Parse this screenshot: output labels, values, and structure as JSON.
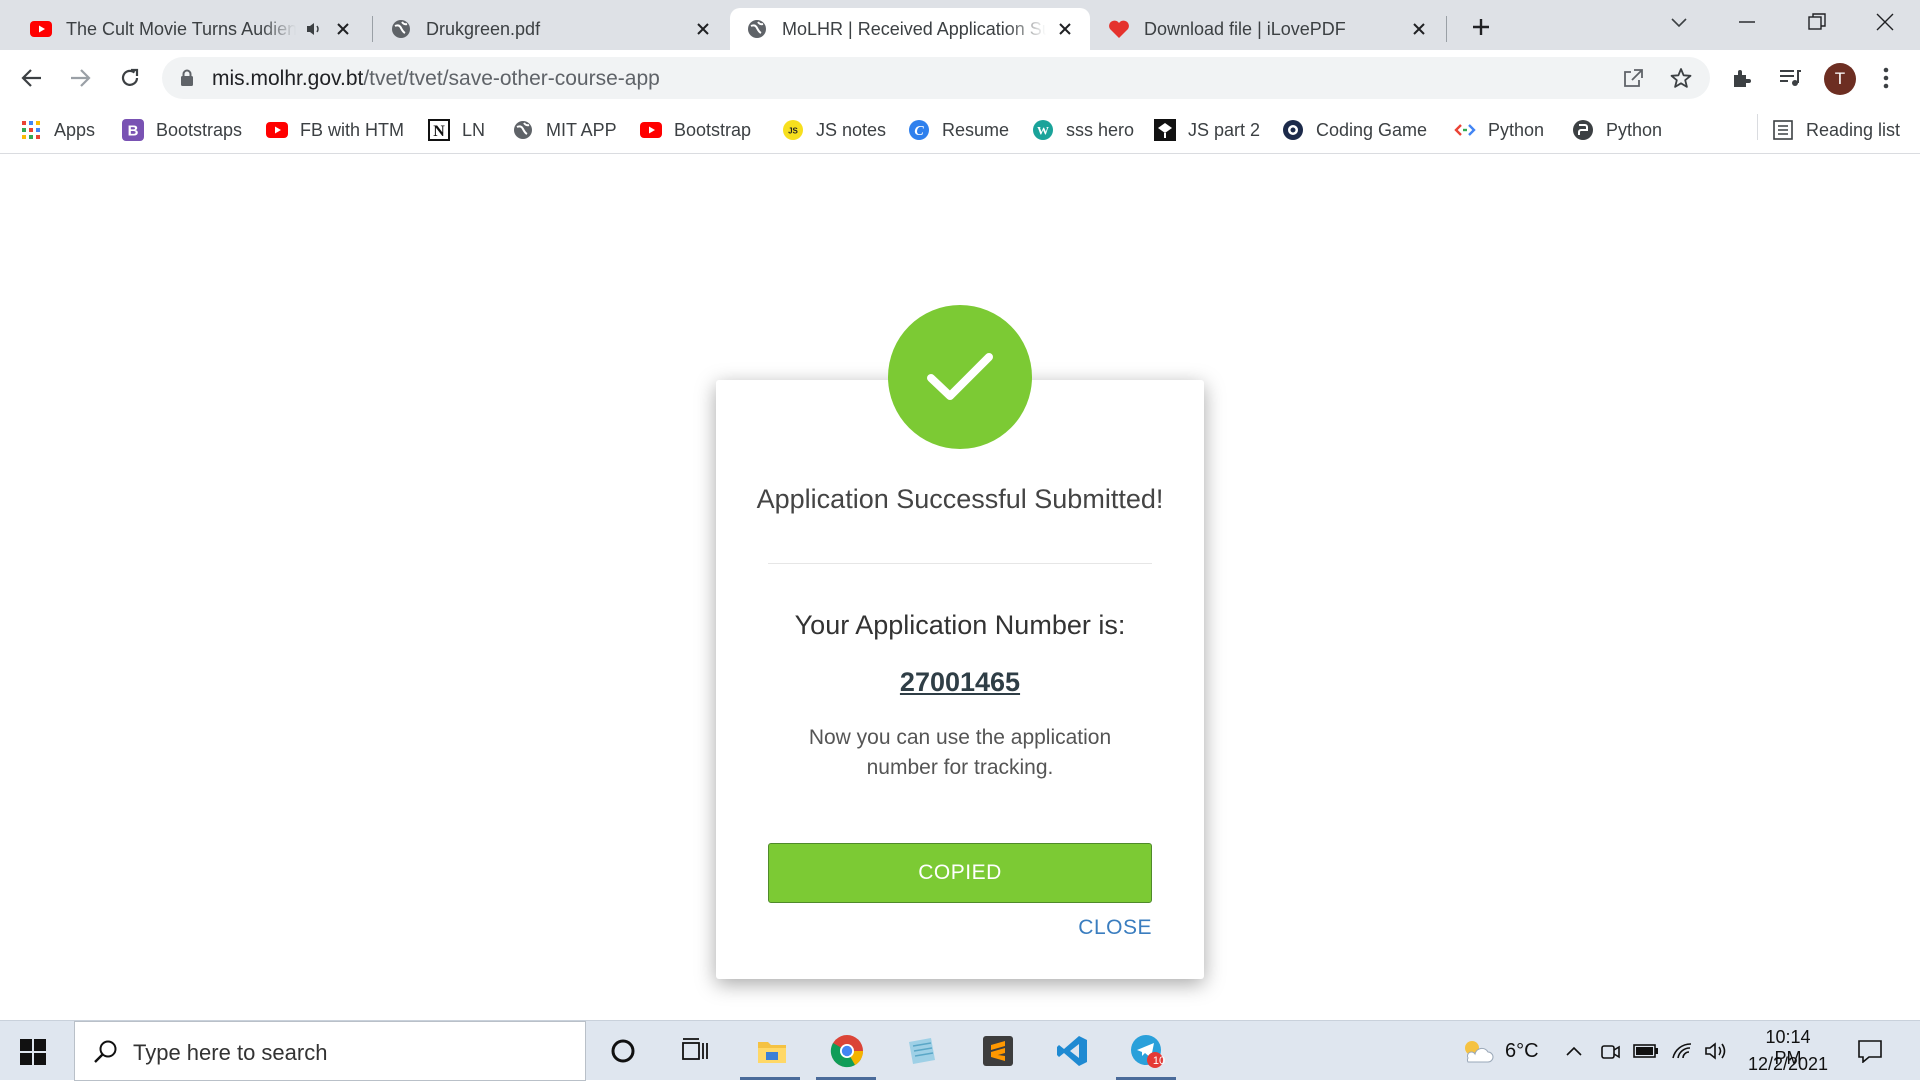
{
  "tabs": [
    {
      "title": "The Cult Movie Turns Audien",
      "favicon": "youtube-icon",
      "muted_icon": "speaker-icon"
    },
    {
      "title": "Drukgreen.pdf",
      "favicon": "globe-icon"
    },
    {
      "title": "MoLHR | Received Application Su",
      "favicon": "globe-icon",
      "active": true
    },
    {
      "title": "Download file | iLovePDF",
      "favicon": "heart-icon"
    }
  ],
  "address_bar": {
    "domain": "mis.molhr.gov.bt",
    "path": "/tvet/tvet/save-other-course-app"
  },
  "profile": {
    "initial": "T"
  },
  "bookmarks": [
    {
      "label": "Apps",
      "icon": "apps-grid-icon"
    },
    {
      "label": "Bootstraps",
      "icon": "bootstrap-icon"
    },
    {
      "label": "FB with HTM",
      "icon": "youtube-icon"
    },
    {
      "label": "LN",
      "icon": "notion-icon"
    },
    {
      "label": "MIT APP",
      "icon": "globe-icon"
    },
    {
      "label": "Bootstrap",
      "icon": "youtube-icon"
    },
    {
      "label": "JS notes",
      "icon": "js-icon"
    },
    {
      "label": "Resume",
      "icon": "canva-icon"
    },
    {
      "label": "sss hero",
      "icon": "wordpress-icon"
    },
    {
      "label": "JS part 2",
      "icon": "codepen-icon"
    },
    {
      "label": "Coding Game",
      "icon": "codingame-icon"
    },
    {
      "label": "Python",
      "icon": "code-brackets-icon"
    },
    {
      "label": "Python",
      "icon": "python-icon"
    }
  ],
  "reading_list": {
    "label": "Reading list"
  },
  "modal": {
    "title": "Application Successful Submitted!",
    "number_label": "Your Application Number is:",
    "application_number": "27001465",
    "note": "Now you can use the application number for tracking.",
    "copied_button": "COPIED",
    "close_link": "CLOSE",
    "success_color": "#7cca34",
    "link_color": "#3a7dbf"
  },
  "taskbar": {
    "search_placeholder": "Type here to search",
    "apps": [
      "cortana-icon",
      "task-view-icon",
      "file-explorer-icon",
      "chrome-icon",
      "notepad-icon",
      "sublime-icon",
      "vscode-icon",
      "telegram-icon"
    ],
    "telegram_badge": "10",
    "temperature": "6°C",
    "weather_icon": "partly-cloudy-icon",
    "time": "10:14 PM",
    "date": "12/2/2021"
  }
}
